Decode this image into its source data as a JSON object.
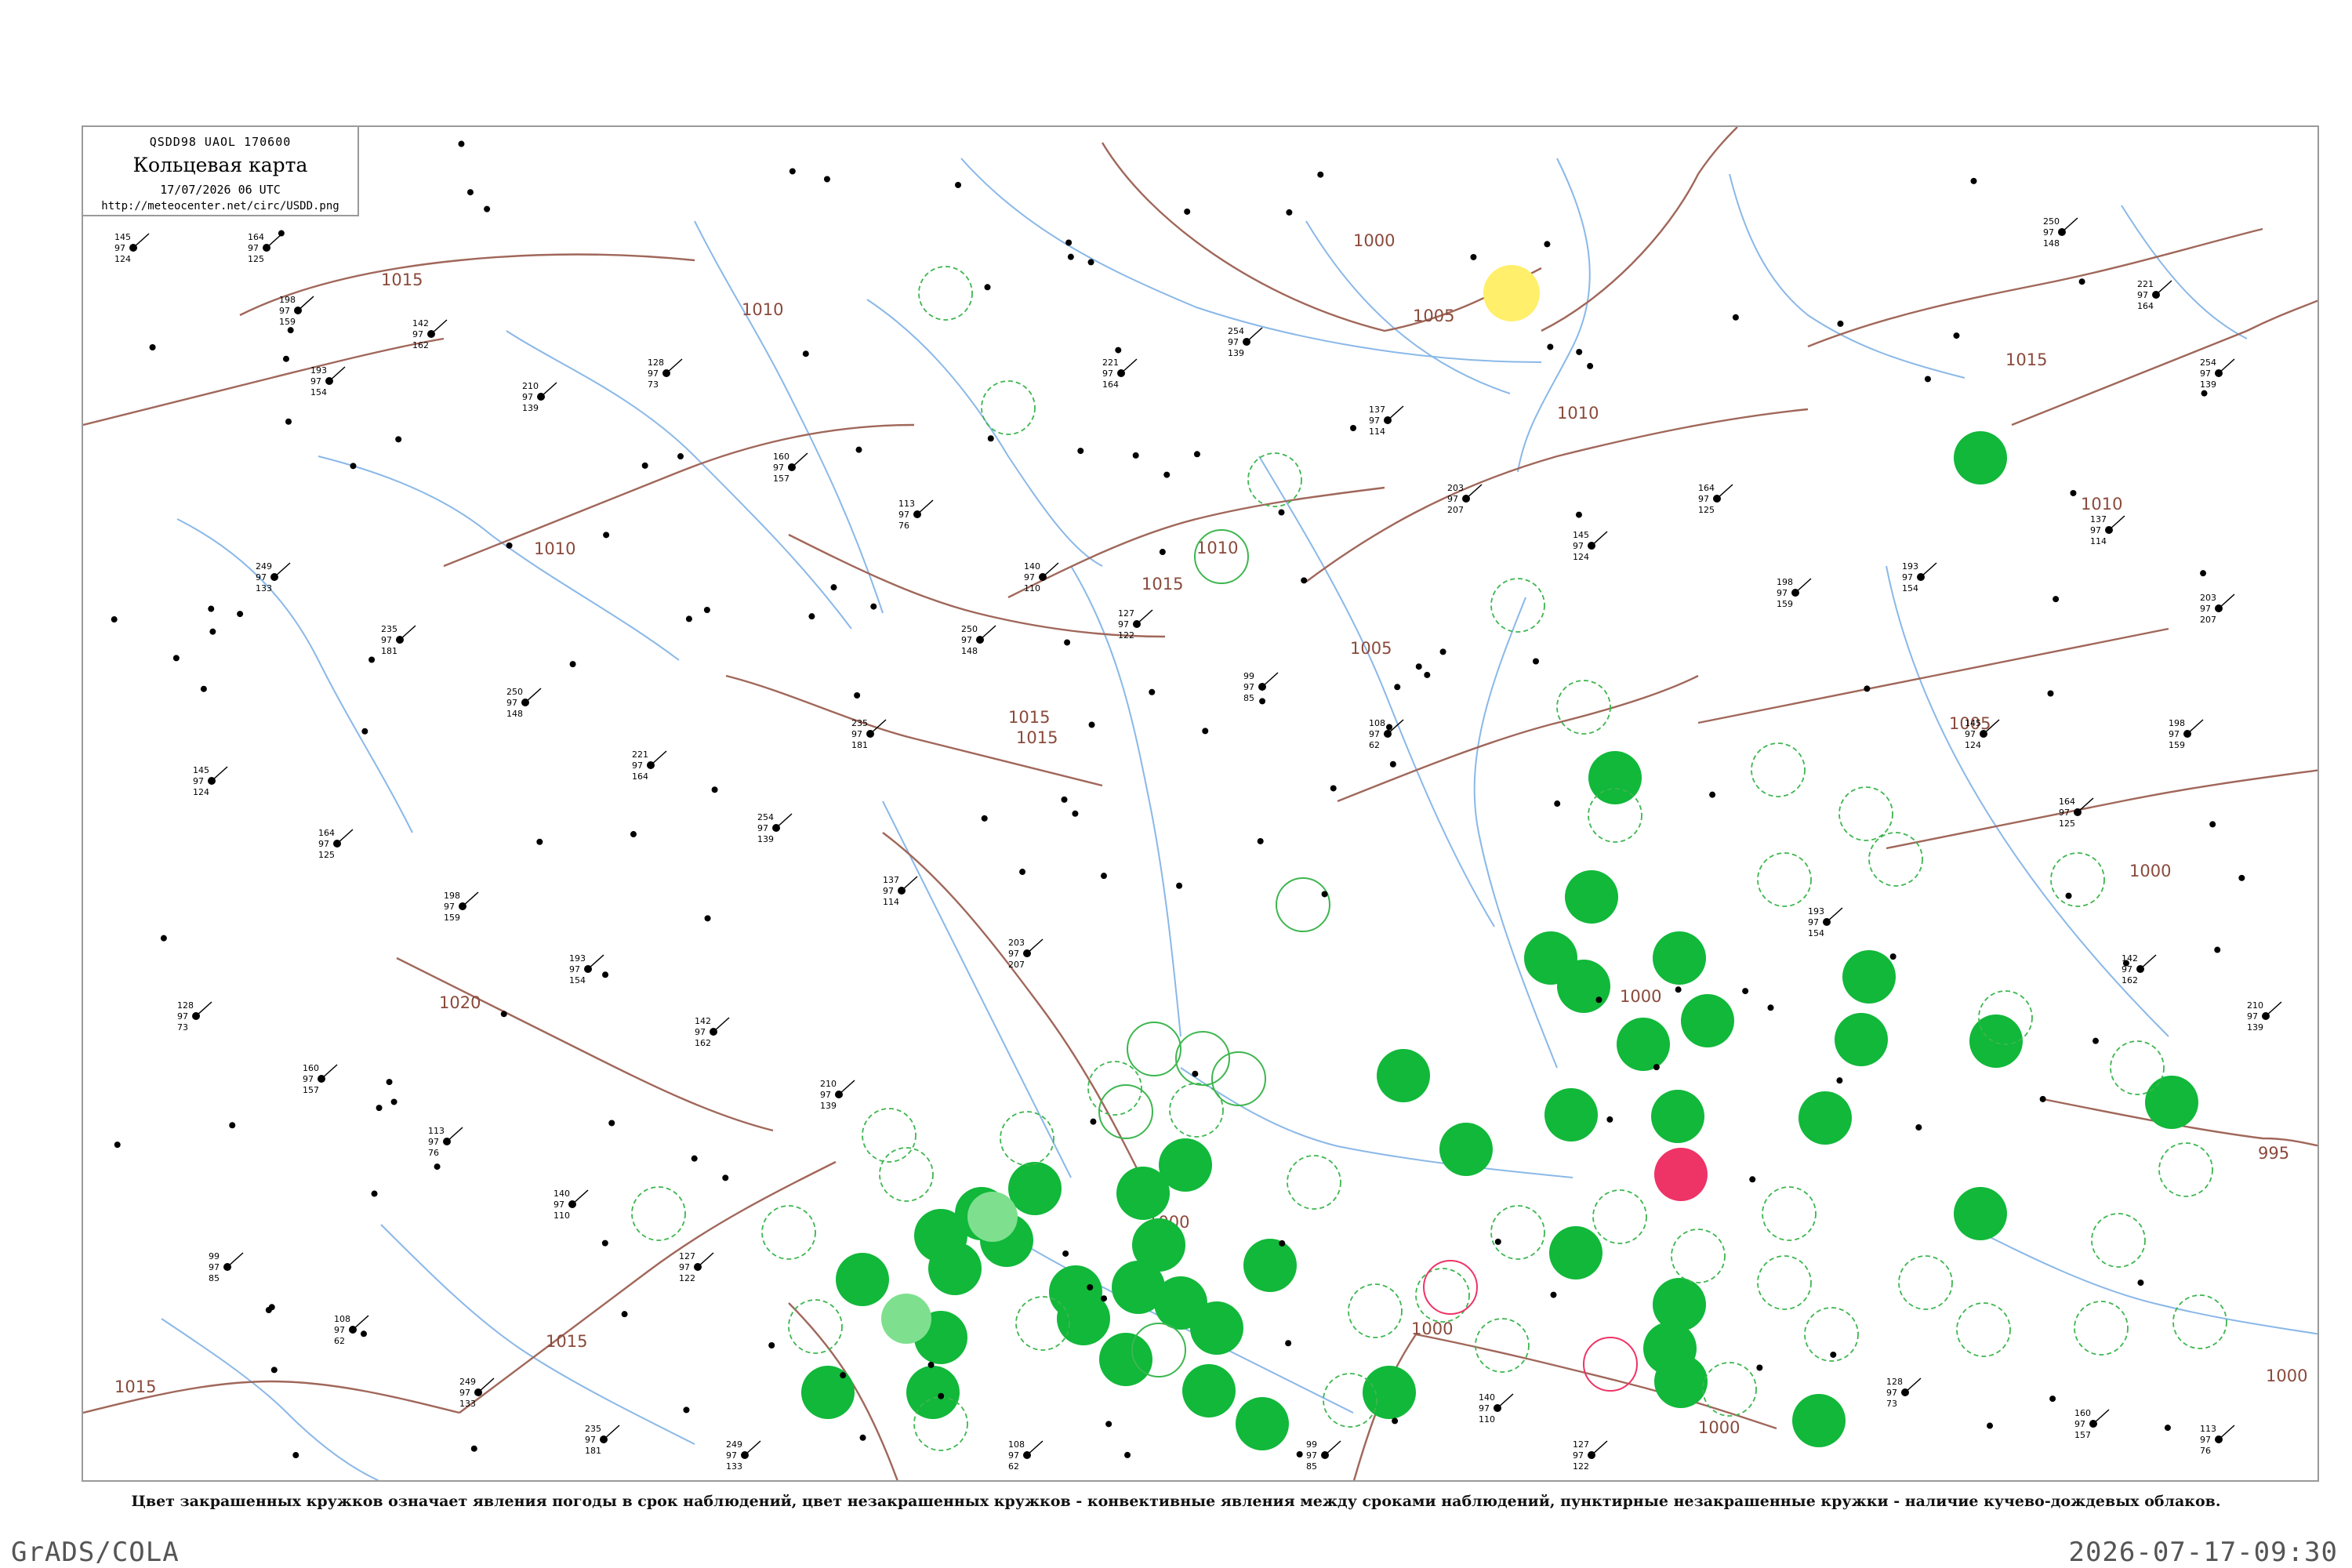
{
  "header": {
    "code": "QSDD98  UAOL  170600",
    "title": "Кольцевая карта",
    "datetime": "17/07/2026 06 UTC",
    "url": "http://meteocenter.net/circ/USDD.png"
  },
  "caption": "Цвет закрашенных кружков означает явления погоды в срок наблюдений, цвет незакрашенных кружков - конвективные явления между сроками наблюдений, пунктирные незакрашенные кружки - наличие кучево-дождевых облаков.",
  "footer": {
    "left": "GrADS/COLA",
    "right": "2026-07-17-09:30"
  },
  "colors": {
    "isobar": "#a0675a",
    "water": "#8ab8e8",
    "station": "#000000",
    "phenomenon_green": "#11b83a",
    "phenomenon_light_green": "#7ee08e",
    "phenomenon_red": "#ee3366",
    "phenomenon_yellow": "#ffef6a",
    "cb_dashed": "#3db64f",
    "frame": "#9a9a9a"
  },
  "isobar_labels": [
    {
      "id": "i1",
      "text": "1000"
    },
    {
      "id": "i2",
      "text": "1005"
    },
    {
      "id": "i3",
      "text": "1010"
    },
    {
      "id": "i4",
      "text": "1015"
    },
    {
      "id": "i5",
      "text": "1015"
    },
    {
      "id": "i6",
      "text": "1010"
    },
    {
      "id": "i7",
      "text": "1010"
    },
    {
      "id": "i8",
      "text": "1015"
    },
    {
      "id": "i9",
      "text": "1010"
    },
    {
      "id": "i10",
      "text": "1005"
    },
    {
      "id": "i11",
      "text": "1000"
    },
    {
      "id": "i12",
      "text": "1000"
    },
    {
      "id": "i13",
      "text": "995"
    },
    {
      "id": "i14",
      "text": "1000"
    },
    {
      "id": "i15",
      "text": "1015"
    },
    {
      "id": "i16",
      "text": "1015"
    },
    {
      "id": "i17",
      "text": "1020"
    },
    {
      "id": "i18",
      "text": "1000"
    },
    {
      "id": "i19",
      "text": "1000"
    },
    {
      "id": "i20",
      "text": "1000"
    },
    {
      "id": "i21",
      "text": "1015"
    },
    {
      "id": "i22",
      "text": "1005"
    },
    {
      "id": "i23",
      "text": "1015"
    },
    {
      "id": "i24",
      "text": "1010"
    }
  ],
  "station_samples": [
    {
      "id": "s1",
      "top": "145",
      "mid": "97",
      "bot": "124"
    },
    {
      "id": "s2",
      "top": "164",
      "mid": "97",
      "bot": "125"
    },
    {
      "id": "s3",
      "top": "198",
      "mid": "97",
      "bot": "159"
    },
    {
      "id": "s4",
      "top": "193",
      "mid": "97",
      "bot": "154"
    },
    {
      "id": "s5",
      "top": "142",
      "mid": "97",
      "bot": "162"
    },
    {
      "id": "s6",
      "top": "210",
      "mid": "97",
      "bot": "139"
    },
    {
      "id": "s7",
      "top": "128",
      "mid": "97",
      "bot": "73"
    },
    {
      "id": "s8",
      "top": "160",
      "mid": "97",
      "bot": "157"
    },
    {
      "id": "s9",
      "top": "113",
      "mid": "97",
      "bot": "76"
    },
    {
      "id": "s10",
      "top": "140",
      "mid": "97",
      "bot": "110"
    },
    {
      "id": "s11",
      "top": "127",
      "mid": "97",
      "bot": "122"
    },
    {
      "id": "s12",
      "top": "99",
      "mid": "97",
      "bot": "85"
    },
    {
      "id": "s13",
      "top": "108",
      "mid": "97",
      "bot": "62"
    },
    {
      "id": "s14",
      "top": "249",
      "mid": "97",
      "bot": "133"
    },
    {
      "id": "s15",
      "top": "235",
      "mid": "97",
      "bot": "181"
    },
    {
      "id": "s16",
      "top": "250",
      "mid": "97",
      "bot": "148"
    },
    {
      "id": "s17",
      "top": "221",
      "mid": "97",
      "bot": "164"
    },
    {
      "id": "s18",
      "top": "254",
      "mid": "97",
      "bot": "139"
    },
    {
      "id": "s19",
      "top": "137",
      "mid": "97",
      "bot": "114"
    },
    {
      "id": "s20",
      "top": "203",
      "mid": "97",
      "bot": "207"
    }
  ]
}
